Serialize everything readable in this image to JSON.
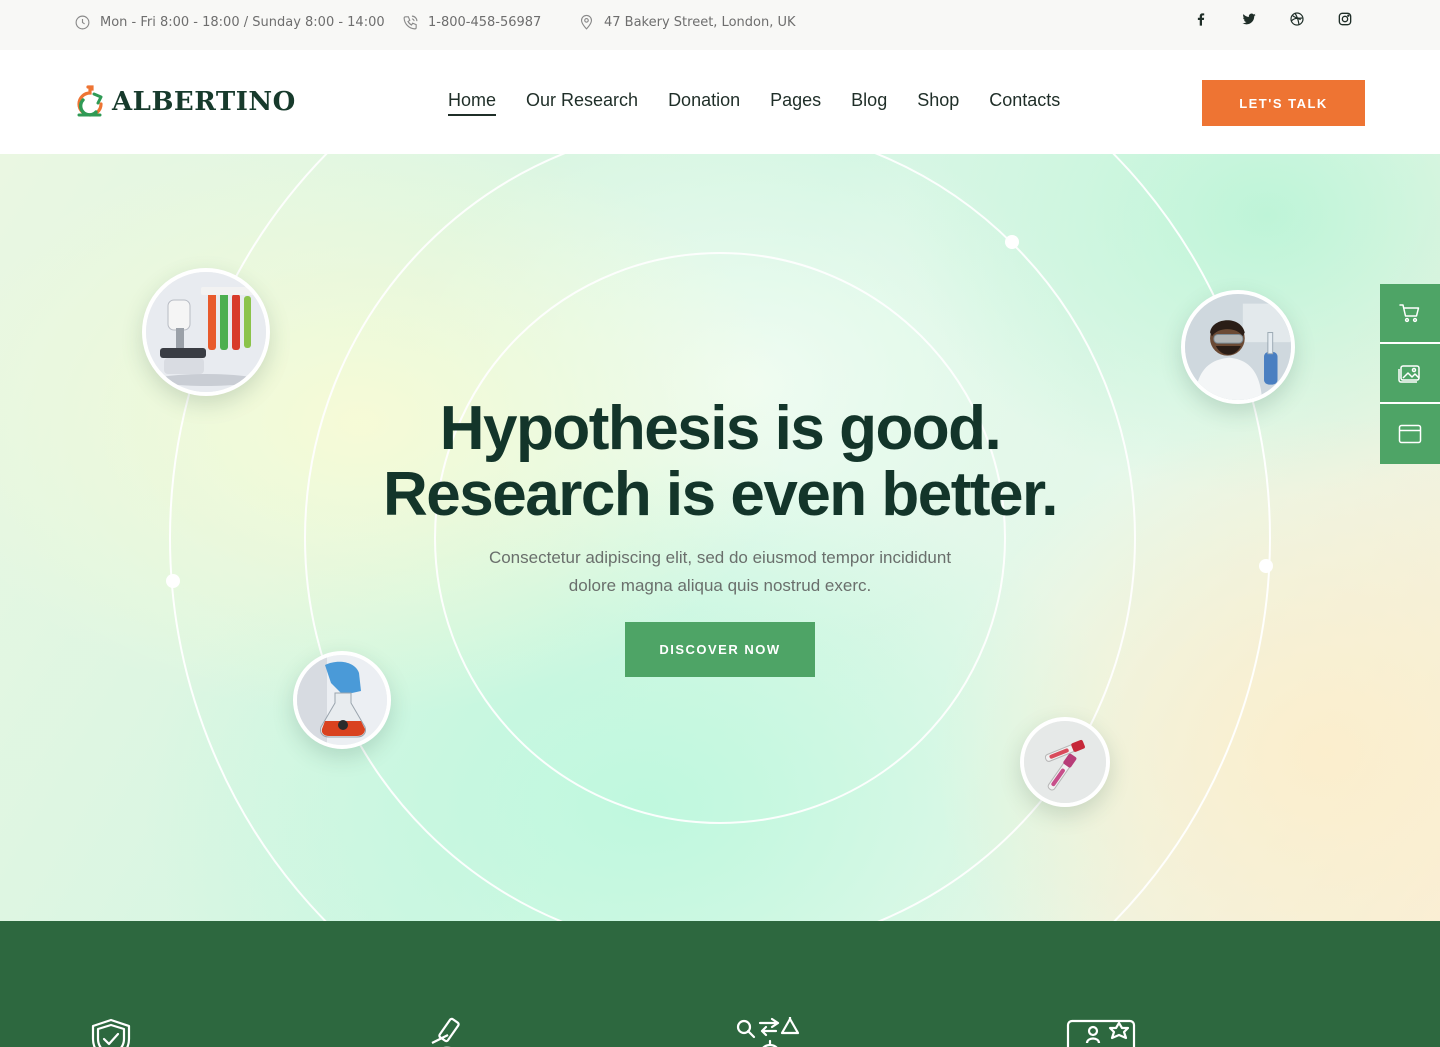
{
  "topbar": {
    "hours": "Mon - Fri 8:00 - 18:00 / Sunday 8:00 - 14:00",
    "phone": "1-800-458-56987",
    "address": "47 Bakery Street, London, UK",
    "social_icons": [
      "facebook-icon",
      "twitter-icon",
      "dribbble-icon",
      "instagram-icon"
    ]
  },
  "header": {
    "logo_text": "ALBERTINO",
    "nav": [
      {
        "label": "Home",
        "active": true
      },
      {
        "label": "Our Research",
        "active": false
      },
      {
        "label": "Donation",
        "active": false
      },
      {
        "label": "Pages",
        "active": false
      },
      {
        "label": "Blog",
        "active": false
      },
      {
        "label": "Shop",
        "active": false
      },
      {
        "label": "Contacts",
        "active": false
      }
    ],
    "cta_label": "LET'S TALK"
  },
  "hero": {
    "title_line1": "Hypothesis is good.",
    "title_line2": "Research is even better.",
    "subtitle": "Consectetur adipiscing elit, sed do eiusmod tempor incididunt dolore magna aliqua quis nostrud exerc.",
    "cta_label": "DISCOVER NOW",
    "images": [
      "microscope-test-tubes",
      "scientist-with-goggles",
      "gloved-hand-flask",
      "blood-sample-tubes"
    ]
  },
  "side_panel": {
    "icons": [
      "cart-icon",
      "gallery-icon",
      "browser-window-icon"
    ]
  },
  "features": {
    "icons": [
      "shield-check-icon",
      "microscope-icon",
      "gear-flow-icon",
      "certificate-icon"
    ]
  },
  "colors": {
    "accent_orange": "#ee7433",
    "accent_green": "#4ea466",
    "dark_green": "#2d683f",
    "heading": "#13352a"
  }
}
